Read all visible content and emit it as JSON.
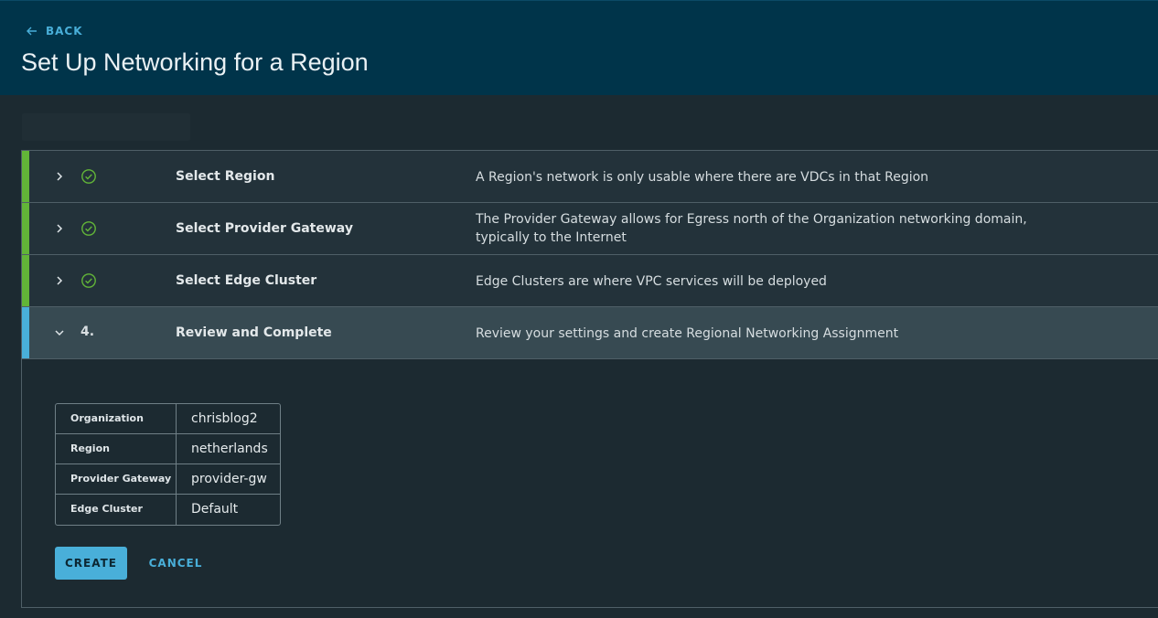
{
  "header": {
    "back_label": "BACK",
    "title": "Set Up Networking for a Region"
  },
  "steps": [
    {
      "status": "complete",
      "icon": "check-circle-icon",
      "number": "",
      "title": "Select Region",
      "description": "A Region's network is only usable where there are VDCs in that Region",
      "expanded": false
    },
    {
      "status": "complete",
      "icon": "check-circle-icon",
      "number": "",
      "title": "Select Provider Gateway",
      "description": "The Provider Gateway allows for Egress north of the Organization networking domain, typically to the Internet",
      "expanded": false
    },
    {
      "status": "complete",
      "icon": "check-circle-icon",
      "number": "",
      "title": "Select Edge Cluster",
      "description": "Edge Clusters are where VPC services will be deployed",
      "expanded": false
    },
    {
      "status": "current",
      "icon": "",
      "number": "4.",
      "title": "Review and Complete",
      "description": "Review your settings and create Regional Networking Assignment",
      "expanded": true
    }
  ],
  "summary": [
    {
      "label": "Organization",
      "value": "chrisblog2"
    },
    {
      "label": "Region",
      "value": "netherlands"
    },
    {
      "label": "Provider Gateway",
      "value": "provider-gw"
    },
    {
      "label": "Edge Cluster",
      "value": "Default"
    }
  ],
  "actions": {
    "create_label": "CREATE",
    "cancel_label": "CANCEL"
  },
  "colors": {
    "header_bg": "#00344a",
    "accent": "#49afd9",
    "complete": "#62b538"
  }
}
